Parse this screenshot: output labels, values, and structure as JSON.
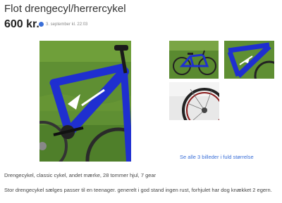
{
  "listing": {
    "title": "Flot drengecyl/herrercykel",
    "price": "600 kr.",
    "posted": "3. september kl. 22:03"
  },
  "gallery": {
    "see_all_label": "Se alle 3 billeder i fuld størrelse",
    "images": [
      {
        "icon": "blue-bicycle-photo"
      },
      {
        "icon": "bicycle-on-lawn-photo"
      },
      {
        "icon": "bicycle-frame-closeup-photo"
      },
      {
        "icon": "bicycle-wheel-closeup-photo"
      }
    ]
  },
  "details": {
    "summary": "Drengecykel, classic cykel, andet mærke, 28 tommer hjul, 7 gear",
    "description": "Stor drengecykel sælges passer til en teenager. generelt i god stand ingen rust, forhjulet har dog knækket 2 egern."
  },
  "colors": {
    "accent": "#3a6fd8",
    "bike_blue": "#1f2fd0",
    "grass": "#5f8f33"
  }
}
